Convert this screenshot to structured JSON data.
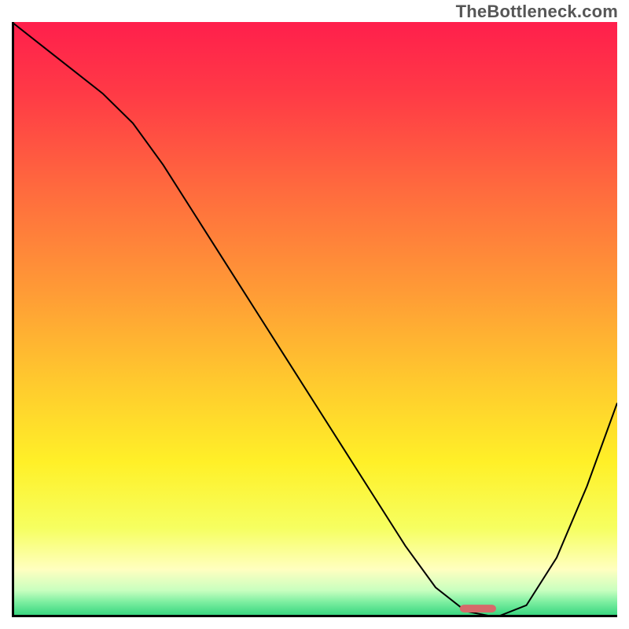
{
  "watermark": "TheBottleneck.com",
  "chart_data": {
    "type": "line",
    "title": "",
    "xlabel": "",
    "ylabel": "",
    "xlim": [
      0,
      100
    ],
    "ylim": [
      0,
      100
    ],
    "grid": false,
    "series": [
      {
        "name": "curve",
        "color": "#000000",
        "x": [
          0,
          5,
          10,
          15,
          20,
          25,
          30,
          35,
          40,
          45,
          50,
          55,
          60,
          65,
          70,
          75,
          80,
          85,
          90,
          95,
          100
        ],
        "y": [
          100,
          96,
          92,
          88,
          83,
          76,
          68,
          60,
          52,
          44,
          36,
          28,
          20,
          12,
          5,
          1,
          0,
          2,
          10,
          22,
          36
        ]
      }
    ],
    "marker": {
      "name": "optimal-range",
      "color": "#d66a6a",
      "x_start": 74,
      "x_end": 80,
      "y": 0.8,
      "height": 1.3
    },
    "background_gradient": {
      "stops": [
        {
          "offset": 0.0,
          "color": "#ff1f4c"
        },
        {
          "offset": 0.12,
          "color": "#ff3a46"
        },
        {
          "offset": 0.28,
          "color": "#ff6a3e"
        },
        {
          "offset": 0.45,
          "color": "#ff9a36"
        },
        {
          "offset": 0.6,
          "color": "#ffc82e"
        },
        {
          "offset": 0.74,
          "color": "#fff028"
        },
        {
          "offset": 0.85,
          "color": "#f6ff60"
        },
        {
          "offset": 0.92,
          "color": "#ffffc0"
        },
        {
          "offset": 0.955,
          "color": "#c8ffbf"
        },
        {
          "offset": 0.975,
          "color": "#7beea0"
        },
        {
          "offset": 1.0,
          "color": "#2fd27a"
        }
      ]
    }
  }
}
